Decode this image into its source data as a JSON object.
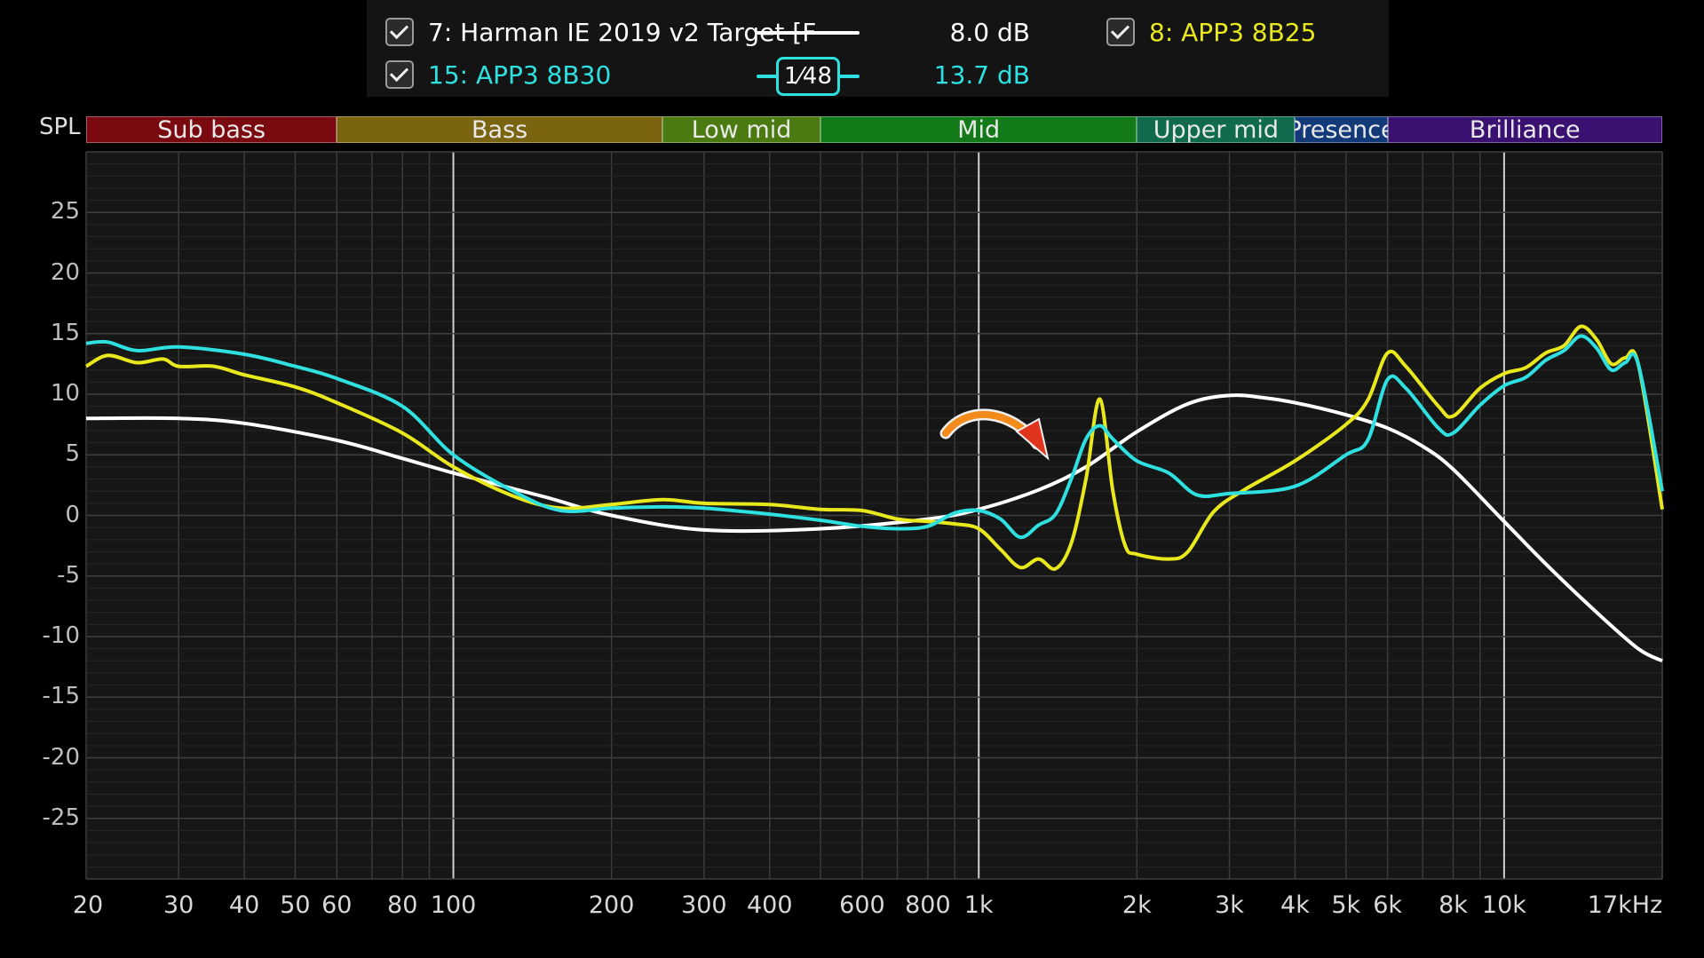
{
  "legend": {
    "entries": [
      {
        "label": "7: Harman IE 2019 v2 Target [F",
        "gain": "8.0 dB",
        "color": "#ffffff",
        "checked": true
      },
      {
        "label": "8: APP3 8B25",
        "gain": "",
        "color": "#e8e81c",
        "checked": true
      },
      {
        "label": "15: APP3 8B30",
        "gain": "13.7 dB",
        "color": "#2ee0e0",
        "checked": true
      }
    ],
    "smoothing": "1⁄48"
  },
  "bands": [
    {
      "label": "Sub bass",
      "from": 20,
      "to": 60,
      "color": "#7a0a10"
    },
    {
      "label": "Bass",
      "from": 60,
      "to": 250,
      "color": "#7a6410"
    },
    {
      "label": "Low mid",
      "from": 250,
      "to": 500,
      "color": "#4a7a10"
    },
    {
      "label": "Mid",
      "from": 500,
      "to": 2000,
      "color": "#127a18"
    },
    {
      "label": "Upper mid",
      "from": 2000,
      "to": 4000,
      "color": "#0f6a4e"
    },
    {
      "label": "Presence",
      "from": 4000,
      "to": 6000,
      "color": "#133a78"
    },
    {
      "label": "Brilliance",
      "from": 6000,
      "to": 20000,
      "color": "#3a1070"
    }
  ],
  "chart_data": {
    "type": "line",
    "ylabel": "SPL",
    "xlabel": "",
    "xscale": "log",
    "xlim": [
      20,
      20000
    ],
    "ylim": [
      -30,
      30
    ],
    "grid": true,
    "yticks": [
      25,
      20,
      15,
      10,
      5,
      0,
      -5,
      -10,
      -15,
      -20,
      -25
    ],
    "xticks": [
      {
        "value": 20,
        "label": "20"
      },
      {
        "value": 30,
        "label": "30"
      },
      {
        "value": 40,
        "label": "40"
      },
      {
        "value": 50,
        "label": "50"
      },
      {
        "value": 60,
        "label": "60"
      },
      {
        "value": 80,
        "label": "80"
      },
      {
        "value": 100,
        "label": "100"
      },
      {
        "value": 200,
        "label": "200"
      },
      {
        "value": 300,
        "label": "300"
      },
      {
        "value": 400,
        "label": "400"
      },
      {
        "value": 600,
        "label": "600"
      },
      {
        "value": 800,
        "label": "800"
      },
      {
        "value": 1000,
        "label": "1k"
      },
      {
        "value": 2000,
        "label": "2k"
      },
      {
        "value": 3000,
        "label": "3k"
      },
      {
        "value": 4000,
        "label": "4k"
      },
      {
        "value": 5000,
        "label": "5k"
      },
      {
        "value": 6000,
        "label": "6k"
      },
      {
        "value": 8000,
        "label": "8k"
      },
      {
        "value": 10000,
        "label": "10k"
      },
      {
        "value": 20000,
        "label": "17kHz"
      }
    ],
    "series": [
      {
        "name": "7: Harman IE 2019 v2 Target [F",
        "color": "#ffffff",
        "points": [
          [
            20,
            8
          ],
          [
            30,
            8
          ],
          [
            40,
            7.6
          ],
          [
            60,
            6.2
          ],
          [
            80,
            4.7
          ],
          [
            100,
            3.5
          ],
          [
            150,
            1.5
          ],
          [
            200,
            0
          ],
          [
            300,
            -1.2
          ],
          [
            500,
            -1.1
          ],
          [
            800,
            -0.3
          ],
          [
            1000,
            0.5
          ],
          [
            1300,
            2.1
          ],
          [
            1600,
            4
          ],
          [
            2000,
            6.9
          ],
          [
            2500,
            9.2
          ],
          [
            3000,
            9.9
          ],
          [
            3500,
            9.7
          ],
          [
            4000,
            9.3
          ],
          [
            5000,
            8.3
          ],
          [
            6000,
            7.2
          ],
          [
            7000,
            5.7
          ],
          [
            8000,
            3.8
          ],
          [
            10000,
            -0.5
          ],
          [
            12000,
            -4
          ],
          [
            15000,
            -8
          ],
          [
            18000,
            -11
          ],
          [
            20000,
            -12
          ]
        ]
      },
      {
        "name": "8: APP3 8B25",
        "color": "#e8e81c",
        "points": [
          [
            20,
            12.3
          ],
          [
            22,
            13.2
          ],
          [
            25,
            12.6
          ],
          [
            28,
            12.9
          ],
          [
            30,
            12.3
          ],
          [
            35,
            12.3
          ],
          [
            40,
            11.6
          ],
          [
            50,
            10.6
          ],
          [
            60,
            9.3
          ],
          [
            80,
            6.8
          ],
          [
            100,
            4
          ],
          [
            130,
            1.6
          ],
          [
            160,
            0.6
          ],
          [
            200,
            0.9
          ],
          [
            250,
            1.3
          ],
          [
            300,
            1
          ],
          [
            400,
            0.9
          ],
          [
            500,
            0.5
          ],
          [
            600,
            0.4
          ],
          [
            700,
            -0.3
          ],
          [
            800,
            -0.5
          ],
          [
            900,
            -0.7
          ],
          [
            1000,
            -1.1
          ],
          [
            1100,
            -2.8
          ],
          [
            1200,
            -4.3
          ],
          [
            1300,
            -3.6
          ],
          [
            1400,
            -4.4
          ],
          [
            1500,
            -2.3
          ],
          [
            1600,
            3
          ],
          [
            1700,
            9.6
          ],
          [
            1800,
            2
          ],
          [
            1900,
            -2.5
          ],
          [
            2000,
            -3.2
          ],
          [
            2300,
            -3.6
          ],
          [
            2500,
            -3
          ],
          [
            2800,
            0.3
          ],
          [
            3200,
            2.1
          ],
          [
            4000,
            4.5
          ],
          [
            5000,
            7.5
          ],
          [
            5500,
            9.5
          ],
          [
            6000,
            13.4
          ],
          [
            6500,
            12.3
          ],
          [
            7500,
            9
          ],
          [
            8000,
            8.2
          ],
          [
            9000,
            10.5
          ],
          [
            10000,
            11.7
          ],
          [
            11000,
            12.2
          ],
          [
            12000,
            13.4
          ],
          [
            13000,
            14
          ],
          [
            14000,
            15.6
          ],
          [
            15000,
            14.5
          ],
          [
            16000,
            12.5
          ],
          [
            17000,
            13
          ],
          [
            18000,
            12.5
          ],
          [
            20000,
            0.5
          ]
        ]
      },
      {
        "name": "15: APP3 8B30",
        "color": "#2ee0e0",
        "points": [
          [
            20,
            14.2
          ],
          [
            22,
            14.3
          ],
          [
            25,
            13.6
          ],
          [
            30,
            13.9
          ],
          [
            40,
            13.3
          ],
          [
            50,
            12.3
          ],
          [
            60,
            11.3
          ],
          [
            80,
            9
          ],
          [
            100,
            5
          ],
          [
            130,
            2
          ],
          [
            160,
            0.4
          ],
          [
            200,
            0.6
          ],
          [
            250,
            0.7
          ],
          [
            300,
            0.6
          ],
          [
            400,
            0.1
          ],
          [
            500,
            -0.4
          ],
          [
            600,
            -0.9
          ],
          [
            700,
            -1.1
          ],
          [
            800,
            -0.9
          ],
          [
            900,
            0.2
          ],
          [
            1000,
            0.4
          ],
          [
            1100,
            -0.3
          ],
          [
            1200,
            -1.8
          ],
          [
            1300,
            -0.8
          ],
          [
            1400,
            0.1
          ],
          [
            1500,
            3
          ],
          [
            1600,
            6.3
          ],
          [
            1700,
            7.4
          ],
          [
            1800,
            6.3
          ],
          [
            2000,
            4.5
          ],
          [
            2300,
            3.5
          ],
          [
            2600,
            1.7
          ],
          [
            3000,
            1.8
          ],
          [
            4000,
            2.4
          ],
          [
            5000,
            5
          ],
          [
            5500,
            6.2
          ],
          [
            6000,
            11.2
          ],
          [
            6500,
            10.5
          ],
          [
            7500,
            7.2
          ],
          [
            8000,
            6.8
          ],
          [
            9000,
            9.1
          ],
          [
            10000,
            10.7
          ],
          [
            11000,
            11.4
          ],
          [
            12000,
            12.8
          ],
          [
            13000,
            13.6
          ],
          [
            14000,
            14.8
          ],
          [
            15000,
            13.8
          ],
          [
            16000,
            12
          ],
          [
            17000,
            12.6
          ],
          [
            18000,
            12.5
          ],
          [
            20000,
            2
          ]
        ]
      }
    ]
  }
}
